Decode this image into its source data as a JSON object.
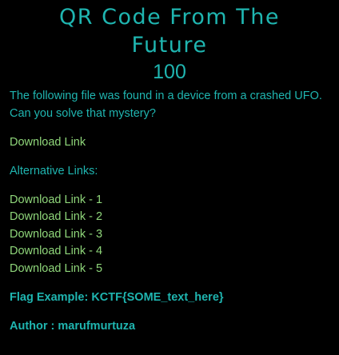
{
  "challenge": {
    "title_line1": "QR Code From The",
    "title_line2": "Future",
    "points": "100",
    "description_line1": "The following file was found in a device from a crashed UFO.",
    "description_line2": "Can you solve that mystery?",
    "download_link": "Download Link",
    "alternative_label": "Alternative Links:",
    "alt_links": [
      "Download Link - 1",
      "Download Link - 2",
      "Download Link - 3",
      "Download Link - 4",
      "Download Link - 5"
    ],
    "flag_example": "Flag Example: KCTF{SOME_text_here}",
    "author": "Author : marufmurtuza"
  },
  "colors": {
    "background": "#000000",
    "text": "#1fb5b0",
    "link": "#8fd67a"
  }
}
